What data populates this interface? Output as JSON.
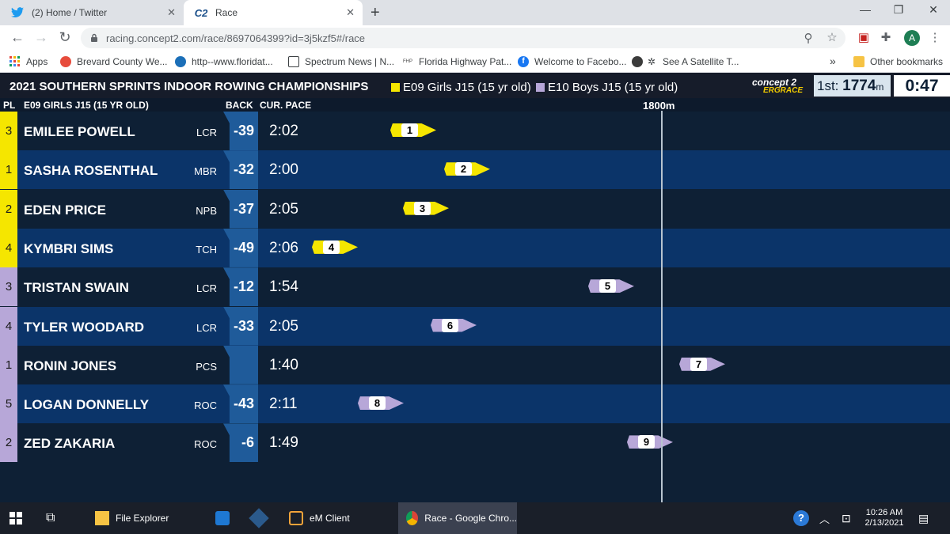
{
  "browser": {
    "tabs": [
      {
        "title": "(2) Home / Twitter",
        "icon": "twitter-icon"
      },
      {
        "title": "Race",
        "icon": "concept2-icon"
      }
    ],
    "url": "racing.concept2.com/race/8697064399?id=3j5kzf5#/race",
    "avatar_letter": "A",
    "bookmarks": [
      {
        "label": "Apps",
        "icon": "apps-grid-icon"
      },
      {
        "label": "Brevard County We...",
        "icon": "weather-icon"
      },
      {
        "label": "http--www.floridat...",
        "icon": "globe-icon"
      },
      {
        "label": "Spectrum News | N...",
        "icon": "news-icon"
      },
      {
        "label": "Florida Highway Pat...",
        "icon": "fhp-icon"
      },
      {
        "label": "Welcome to Facebo...",
        "icon": "facebook-icon"
      },
      {
        "label": "See A Satellite T...",
        "icon": "satellite-icon"
      }
    ],
    "other_bookmarks": "Other bookmarks",
    "overflow": "»"
  },
  "race": {
    "title": "2021 SOUTHERN SPRINTS INDOOR ROWING CHAMPIONSHIPS",
    "events": [
      {
        "label": "E09 Girls J15 (15 yr old)",
        "color": "#f5e600"
      },
      {
        "label": "E10 Boys J15 (15 yr old)",
        "color": "#b7a7d8"
      }
    ],
    "brand_top": "concept 2",
    "brand_bottom": "ERGRACE",
    "leader_prefix": "1st:",
    "leader_value": "1774",
    "leader_unit": "m",
    "clock": "0:47",
    "columns": {
      "pl": "PL",
      "event": "E09 GIRLS J15 (15 YR OLD)",
      "back": "BACK",
      "pace": "CUR. PACE"
    },
    "distance_label": "1800m",
    "lanes": [
      {
        "pl": "3",
        "name": "EMILEE POWELL",
        "club": "LCR",
        "back": "-39",
        "pace": "2:02",
        "lane": "1",
        "event": 0,
        "progress": 0.786
      },
      {
        "pl": "1",
        "name": "SASHA ROSENTHAL",
        "club": "MBR",
        "back": "-32",
        "pace": "2:00",
        "lane": "2",
        "event": 0,
        "progress": 0.883
      },
      {
        "pl": "2",
        "name": "EDEN PRICE",
        "club": "NPB",
        "back": "-37",
        "pace": "2:05",
        "lane": "3",
        "event": 0,
        "progress": 0.809
      },
      {
        "pl": "4",
        "name": "KYMBRI SIMS",
        "club": "TCH",
        "back": "-49",
        "pace": "2:06",
        "lane": "4",
        "event": 0,
        "progress": 0.645
      },
      {
        "pl": "3",
        "name": "TRISTAN SWAIN",
        "club": "LCR",
        "back": "-12",
        "pace": "1:54",
        "lane": "5",
        "event": 1,
        "progress": 1.144
      },
      {
        "pl": "4",
        "name": "TYLER WOODARD",
        "club": "LCR",
        "back": "-33",
        "pace": "2:05",
        "lane": "6",
        "event": 1,
        "progress": 0.86
      },
      {
        "pl": "1",
        "name": "RONIN JONES",
        "club": "PCS",
        "back": "",
        "pace": "1:40",
        "lane": "7",
        "event": 1,
        "progress": 1.307
      },
      {
        "pl": "5",
        "name": "LOGAN DONNELLY",
        "club": "ROC",
        "back": "-43",
        "pace": "2:11",
        "lane": "8",
        "event": 1,
        "progress": 0.728
      },
      {
        "pl": "2",
        "name": "ZED ZAKARIA",
        "club": "ROC",
        "back": "-6",
        "pace": "1:49",
        "lane": "9",
        "event": 1,
        "progress": 1.213
      }
    ]
  },
  "taskbar": {
    "items": [
      {
        "label": "File Explorer",
        "icon": "folder-icon"
      },
      {
        "label": "eM Client",
        "icon": "mail-icon"
      },
      {
        "label": "Race - Google Chro...",
        "icon": "chrome-icon"
      }
    ],
    "time": "10:26 AM",
    "date": "2/13/2021"
  }
}
